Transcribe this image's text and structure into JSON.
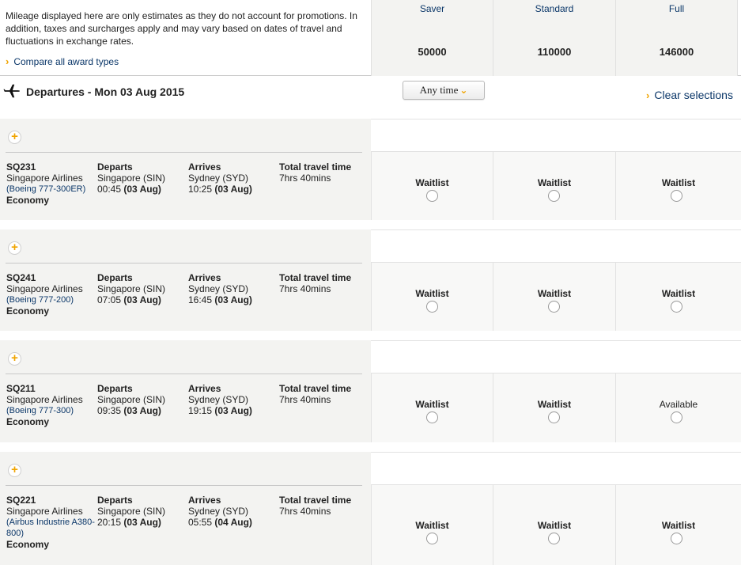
{
  "notice": "Mileage displayed here are only estimates as they do not account for promotions. In addition, taxes and surcharges apply and may vary based on dates of travel and fluctuations in exchange rates.",
  "compare_link": "Compare all award types",
  "award_columns": [
    {
      "name": "Saver",
      "miles": "50000"
    },
    {
      "name": "Standard",
      "miles": "110000"
    },
    {
      "name": "Full",
      "miles": "146000"
    }
  ],
  "departures_title": "Departures - Mon 03 Aug 2015",
  "time_filter": "Any time",
  "clear_selections": "Clear selections",
  "labels": {
    "departs": "Departs",
    "arrives": "Arrives",
    "total": "Total travel time"
  },
  "flights": [
    {
      "number": "SQ231",
      "airline": "Singapore Airlines",
      "aircraft": "(Boeing 777-300ER)",
      "cabin": "Economy",
      "dep_airport": "Singapore (SIN)",
      "dep_time": "00:45",
      "dep_date": "(03 Aug)",
      "arr_airport": "Sydney (SYD)",
      "arr_time": "10:25",
      "arr_date": "(03 Aug)",
      "duration": "7hrs 40mins",
      "status": [
        "Waitlist",
        "Waitlist",
        "Waitlist"
      ]
    },
    {
      "number": "SQ241",
      "airline": "Singapore Airlines",
      "aircraft": "(Boeing 777-200)",
      "cabin": "Economy",
      "dep_airport": "Singapore (SIN)",
      "dep_time": "07:05",
      "dep_date": "(03 Aug)",
      "arr_airport": "Sydney (SYD)",
      "arr_time": "16:45",
      "arr_date": "(03 Aug)",
      "duration": "7hrs 40mins",
      "status": [
        "Waitlist",
        "Waitlist",
        "Waitlist"
      ]
    },
    {
      "number": "SQ211",
      "airline": "Singapore Airlines",
      "aircraft": "(Boeing 777-300)",
      "cabin": "Economy",
      "dep_airport": "Singapore (SIN)",
      "dep_time": "09:35",
      "dep_date": "(03 Aug)",
      "arr_airport": "Sydney (SYD)",
      "arr_time": "19:15",
      "arr_date": "(03 Aug)",
      "duration": "7hrs 40mins",
      "status": [
        "Waitlist",
        "Waitlist",
        "Available"
      ]
    },
    {
      "number": "SQ221",
      "airline": "Singapore Airlines",
      "aircraft": "(Airbus Industrie A380-800)",
      "cabin": "Economy",
      "dep_airport": "Singapore (SIN)",
      "dep_time": "20:15",
      "dep_date": "(03 Aug)",
      "arr_airport": "Sydney (SYD)",
      "arr_time": "05:55",
      "arr_date": "(04 Aug)",
      "duration": "7hrs 40mins",
      "status": [
        "Waitlist",
        "Waitlist",
        "Waitlist"
      ]
    }
  ]
}
